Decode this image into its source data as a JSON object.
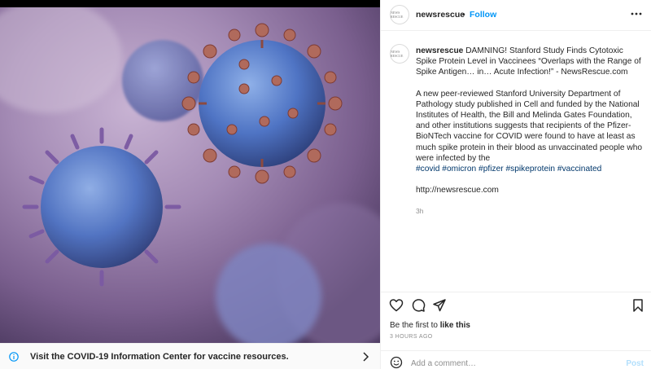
{
  "post": {
    "username": "newsrescue",
    "separator": "•",
    "follow_label": "Follow",
    "more_icon": "more-horizontal-icon",
    "avatar_text": "NEWS RESCUE"
  },
  "caption": {
    "username": "newsrescue",
    "headline": "DAMNING! Stanford Study Finds Cytotoxic Spike Protein Level in Vaccinees “Overlaps with the Range of Spike Antigen… in… Acute Infection!” - NewsRescue.com",
    "paragraph": "A new peer-reviewed Stanford University Department of Pathology study published in Cell and funded by the National Institutes of Health, the Bill and Melinda Gates Foundation, and other institutions suggests that recipients of the Pfizer-BioNTech vaccine for COVID were found to have at least as much spike protein in their blood as unvaccinated people who were infected by the",
    "hashtags": [
      "#covid",
      "#omicron",
      "#pfizer",
      "#spikeprotein",
      "#vaccinated"
    ],
    "link": "http://newsrescue.com",
    "time": "3h"
  },
  "actions": {
    "like_icon": "heart-icon",
    "comment_icon": "comment-icon",
    "share_icon": "share-icon",
    "save_icon": "bookmark-icon"
  },
  "likes": {
    "prefix": "Be the first to",
    "action": "like this"
  },
  "timestamp": "3 HOURS AGO",
  "comment": {
    "placeholder": "Add a comment…",
    "post_label": "Post",
    "emoji_icon": "emoji-icon"
  },
  "banner": {
    "text": "Visit the COVID-19 Information Center for vaccine resources.",
    "info_icon": "info-icon",
    "chevron_icon": "chevron-right-icon"
  },
  "colors": {
    "link_blue": "#0095f6",
    "hashtag": "#00376b",
    "muted": "#8e8e8e",
    "post_disabled": "#b2dffc"
  }
}
